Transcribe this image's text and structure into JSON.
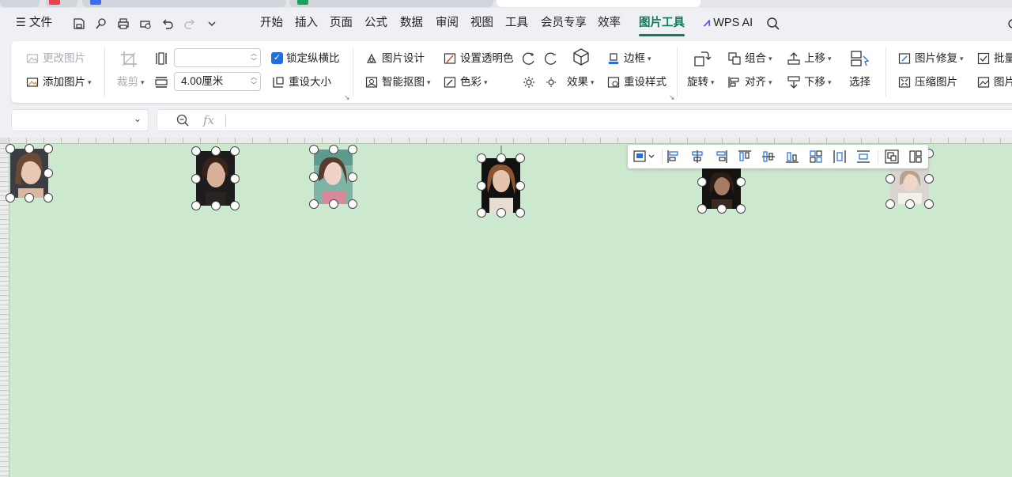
{
  "menubar": {
    "hamburger_label": "文件",
    "tabs": [
      "开始",
      "插入",
      "页面",
      "公式",
      "数据",
      "审阅",
      "视图",
      "工具",
      "会员专享",
      "效率",
      "图片工具"
    ],
    "active_tab": "图片工具",
    "wps_ai": "WPS AI"
  },
  "ribbon": {
    "change_picture": "更改图片",
    "add_picture": "添加图片",
    "crop": "裁剪",
    "width_value": "",
    "height_value": "4.00厘米",
    "lock_ratio": "锁定纵横比",
    "reset_size": "重设大小",
    "picture_design": "图片设计",
    "smart_cutout": "智能抠图",
    "set_transparent": "设置透明色",
    "color": "色彩",
    "effects": "效果",
    "border": "边框",
    "reset_style": "重设样式",
    "rotate": "旋转",
    "group": "组合",
    "align": "对齐",
    "bring_forward": "上移",
    "send_backward": "下移",
    "select": "选择",
    "picture_repair": "图片修复",
    "compress": "压缩图片",
    "batch": "批量",
    "picture_more": "图片"
  },
  "formula_bar": {
    "name_box": "",
    "fx_label": "fx",
    "content": ""
  },
  "colors": {
    "accent": "#0f7a55",
    "sheet_bg": "#cce8cf",
    "checkbox": "#1f6fe0"
  }
}
